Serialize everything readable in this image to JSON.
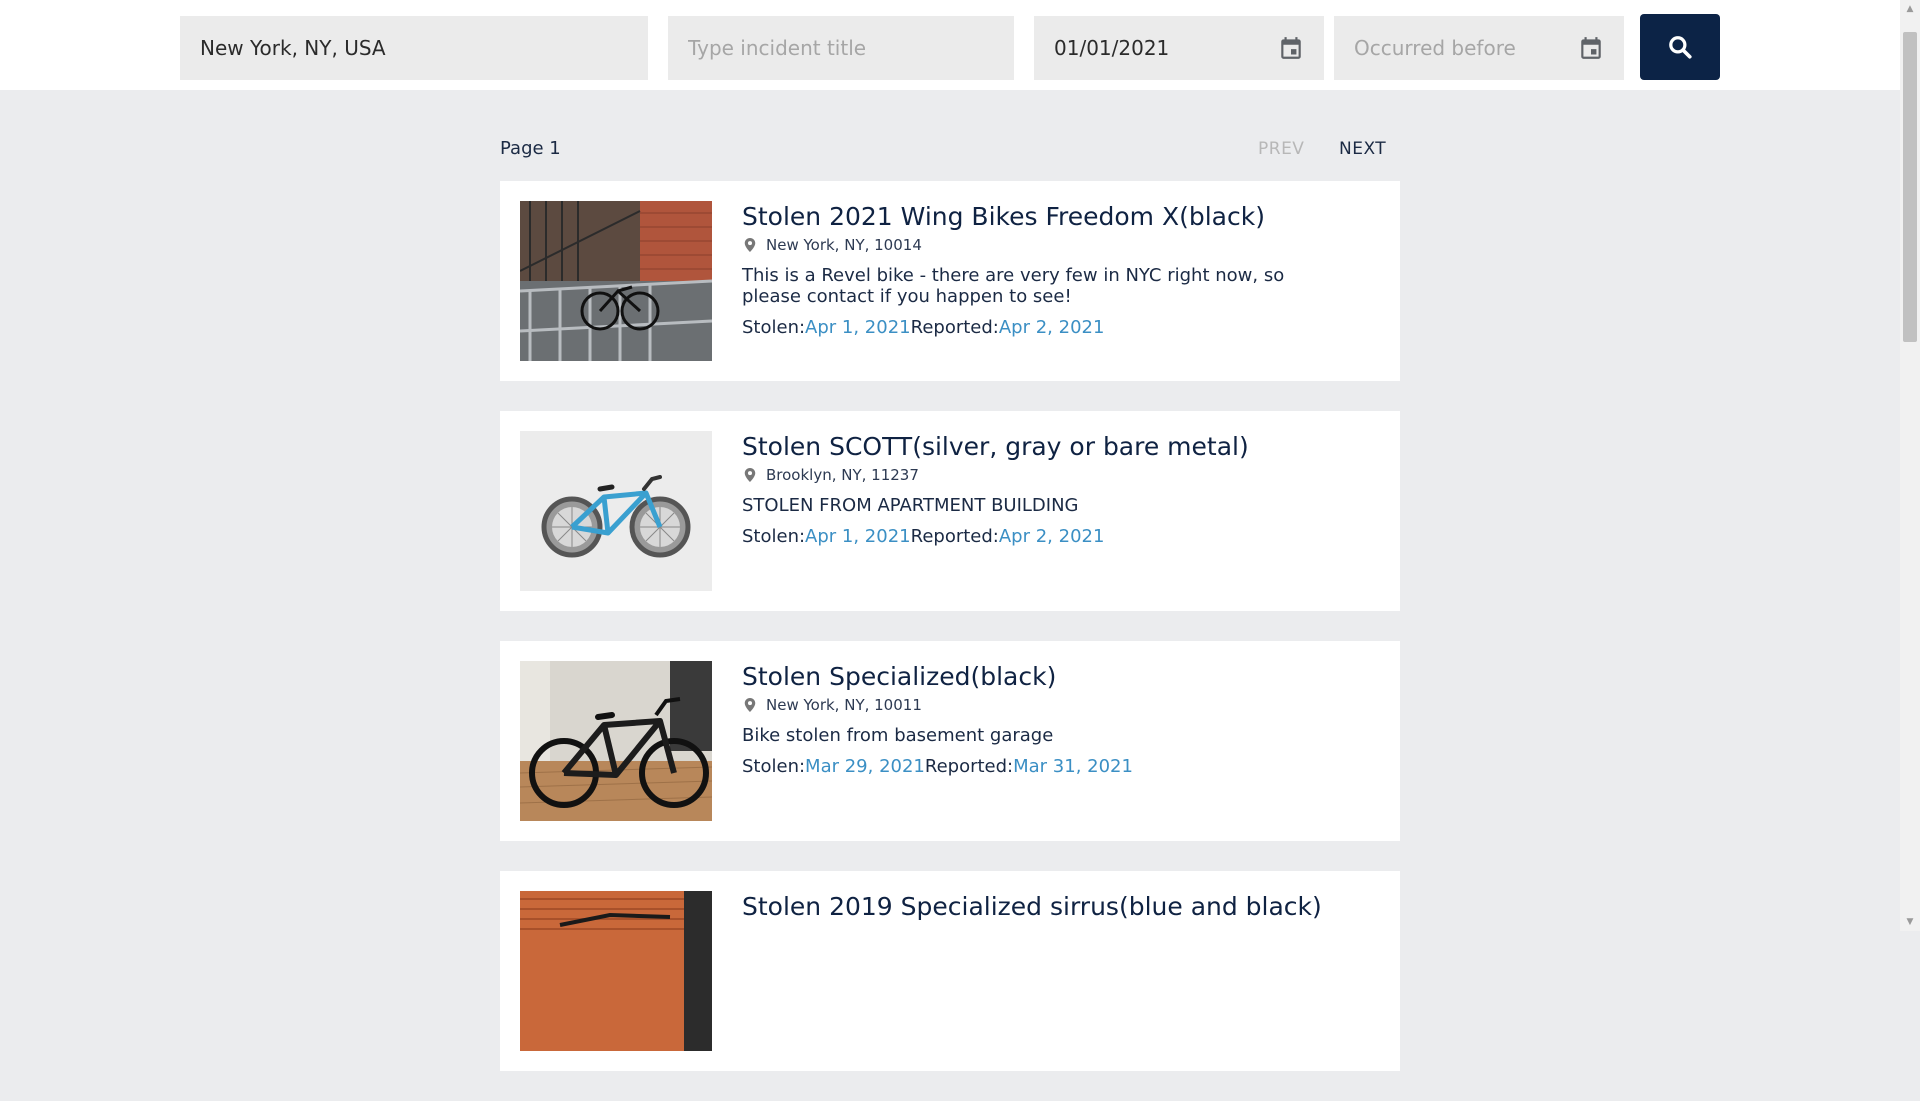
{
  "search": {
    "location_value": "New York, NY, USA",
    "title_placeholder": "Type incident title",
    "occurred_after_value": "01/01/2021",
    "occurred_before_placeholder": "Occurred before",
    "button_icon": "search-icon"
  },
  "pager": {
    "page_label": "Page 1",
    "prev_label": "PREV",
    "next_label": "NEXT"
  },
  "incidents": [
    {
      "title": "Stolen 2021 Wing Bikes Freedom X(black)",
      "location": "New York, NY, 10014",
      "description": "This is a Revel bike - there are very few in NYC right now, so please contact if you happen to see!",
      "stolen_label": "Stolen:",
      "stolen_date": "Apr 1, 2021",
      "reported_label": "Reported:",
      "reported_date": "Apr 2, 2021"
    },
    {
      "title": "Stolen SCOTT(silver, gray or bare metal)",
      "location": "Brooklyn, NY, 11237",
      "description": "STOLEN FROM APARTMENT BUILDING",
      "stolen_label": "Stolen:",
      "stolen_date": "Apr 1, 2021",
      "reported_label": "Reported:",
      "reported_date": "Apr 2, 2021"
    },
    {
      "title": "Stolen Specialized(black)",
      "location": "New York, NY, 10011",
      "description": "Bike stolen from basement garage",
      "stolen_label": "Stolen:",
      "stolen_date": "Mar 29, 2021",
      "reported_label": "Reported:",
      "reported_date": "Mar 31, 2021"
    },
    {
      "title": "Stolen 2019 Specialized sirrus(blue and black)",
      "location": "",
      "description": "",
      "stolen_label": "",
      "stolen_date": "",
      "reported_label": "",
      "reported_date": ""
    }
  ],
  "colors": {
    "navy": "#0c2346",
    "accent_date": "#3b8fc4",
    "page_bg": "#ebecee",
    "field_bg": "#ebebeb"
  }
}
